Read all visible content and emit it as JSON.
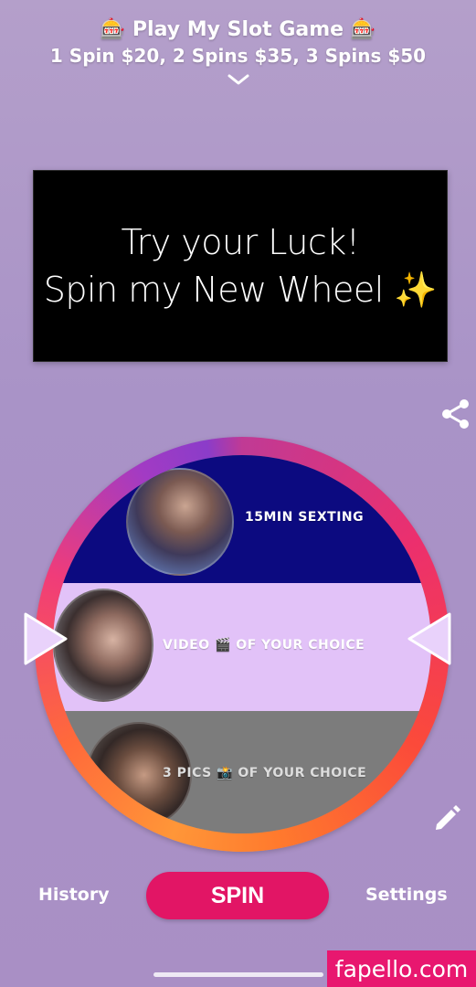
{
  "header": {
    "title": "🎰 Play My Slot Game 🎰",
    "subtitle": "1 Spin $20, 2 Spins $35, 3 Spins $50"
  },
  "banner": {
    "line1": "Try your Luck!",
    "line2": "Spin my New Wheel ✨"
  },
  "wheel": {
    "segments": [
      {
        "label": "15MIN SEXTING",
        "color": "#0c0a80"
      },
      {
        "label": "VIDEO 🎬 OF YOUR CHOICE",
        "color": "#e2c2f8"
      },
      {
        "label": "3 PICS 📸 OF YOUR CHOICE",
        "color": "#7c7c7c"
      }
    ]
  },
  "footer": {
    "history_label": "History",
    "spin_label": "SPIN",
    "settings_label": "Settings"
  },
  "watermark": "fapello.com",
  "colors": {
    "accent": "#e21565",
    "background": "#b49fca"
  },
  "icons": {
    "share": "share-icon",
    "edit": "pencil-icon",
    "expand": "chevron-down-icon"
  }
}
